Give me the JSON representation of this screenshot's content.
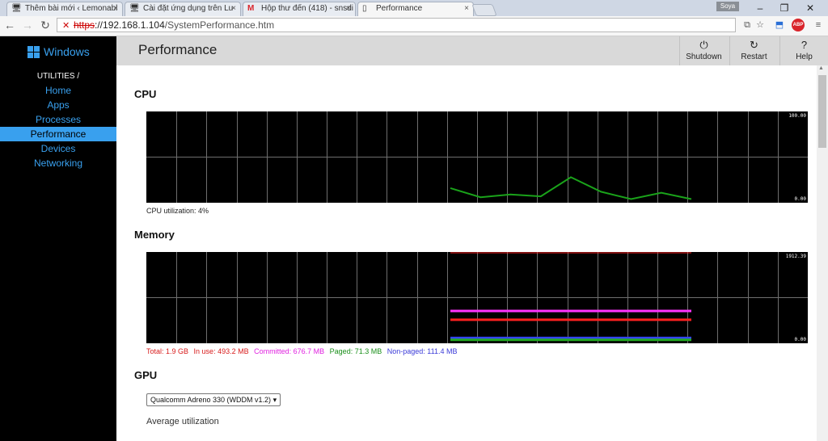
{
  "browser": {
    "tabs": [
      {
        "title": "Thêm bài mới ‹ Lemonabl",
        "icon": "monitor-icon",
        "active": false
      },
      {
        "title": "Cài đặt ứng dụng trên Lu",
        "icon": "monitor-icon",
        "active": false
      },
      {
        "title": "Hộp thư đến (418) - snsdi",
        "icon": "gmail-icon",
        "active": false
      },
      {
        "title": "Performance",
        "icon": "page-icon",
        "active": true
      }
    ],
    "profile_name": "Soya",
    "address": {
      "scheme": "https",
      "rest_host": "://192.168.1.104",
      "path": "/SystemPerformance.htm"
    }
  },
  "sidebar": {
    "logo": "Windows",
    "heading": "UTILITIES /",
    "items": [
      {
        "label": "Home",
        "active": false
      },
      {
        "label": "Apps",
        "active": false
      },
      {
        "label": "Processes",
        "active": false
      },
      {
        "label": "Performance",
        "active": true
      },
      {
        "label": "Devices",
        "active": false
      },
      {
        "label": "Networking",
        "active": false
      }
    ]
  },
  "header": {
    "title": "Performance",
    "buttons": [
      {
        "label": "Shutdown",
        "icon": "power-icon"
      },
      {
        "label": "Restart",
        "icon": "restart-icon"
      },
      {
        "label": "Help",
        "icon": "help-icon"
      }
    ]
  },
  "cpu": {
    "title": "CPU",
    "max_label": "100.00",
    "min_label": "0.00",
    "caption": "CPU utilization: 4%",
    "samples": [
      16,
      6,
      9,
      7,
      28,
      12,
      4,
      11,
      4
    ]
  },
  "memory": {
    "title": "Memory",
    "max_label": "1912.39",
    "min_label": "0.00",
    "total": "Total: 1.9 GB",
    "in_use": "In use: 493.2 MB",
    "committed": "Committed: 676.7 MB",
    "paged": "Paged: 71.3 MB",
    "nonpaged": "Non-paged: 111.4 MB",
    "series_levels": {
      "total": 1912.39,
      "committed": 676.7,
      "in_use": 493.2,
      "nonpaged": 111.4,
      "paged": 71.3
    },
    "colors": {
      "total": "#ff2020",
      "in_use": "#ff2020",
      "committed": "#ff33ff",
      "paged": "#22aa22",
      "nonpaged": "#3344ff"
    }
  },
  "gpu": {
    "title": "GPU",
    "adapter": "Qualcomm Adreno 330 (WDDM v1.2)",
    "avg_label": "Average utilization"
  },
  "colors": {
    "accent": "#39a0ee",
    "cpu_line": "#1aa31a"
  }
}
